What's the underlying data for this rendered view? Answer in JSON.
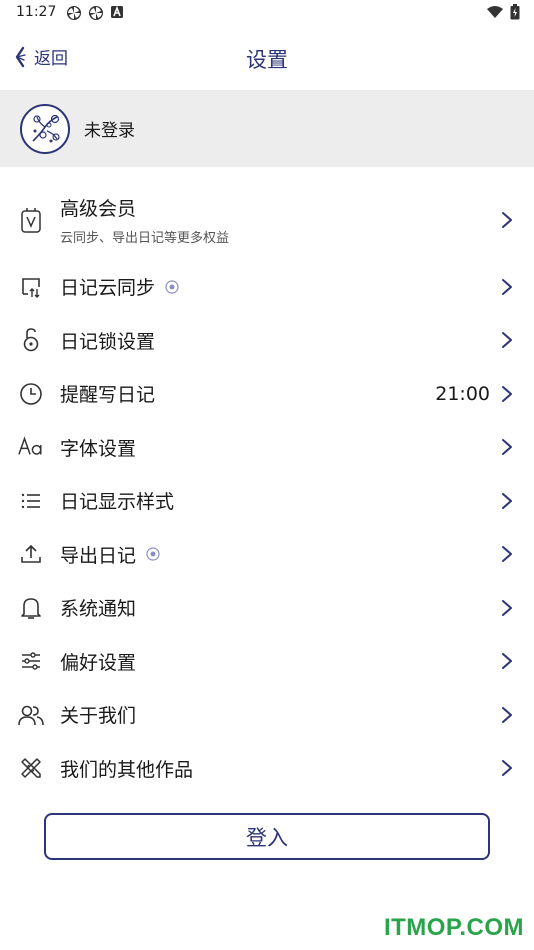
{
  "status_bar": {
    "time": "11:27",
    "left_icons": [
      "pinwheel-icon",
      "pinwheel-icon",
      "a-box-icon"
    ],
    "right_icons": [
      "wifi-icon",
      "battery-icon"
    ]
  },
  "header": {
    "back_label": "返回",
    "title": "设置",
    "back_icon": "back-arrow-icon"
  },
  "profile": {
    "name": "未登录",
    "avatar_icon": "avatar-plum-blossom-icon"
  },
  "menu": {
    "items": [
      {
        "id": "premium",
        "icon": "membership-icon",
        "label": "高级会员",
        "subtitle": "云同步、导出日记等更多权益"
      },
      {
        "id": "sync",
        "icon": "cloud-sync-icon",
        "label": "日记云同步",
        "badge": "premium-badge-icon"
      },
      {
        "id": "lock",
        "icon": "lock-icon",
        "label": "日记锁设置"
      },
      {
        "id": "reminder",
        "icon": "clock-icon",
        "label": "提醒写日记",
        "value": "21:00"
      },
      {
        "id": "font",
        "icon": "font-icon",
        "label": "字体设置"
      },
      {
        "id": "display",
        "icon": "list-icon",
        "label": "日记显示样式"
      },
      {
        "id": "export",
        "icon": "export-icon",
        "label": "导出日记",
        "badge": "premium-badge-icon"
      },
      {
        "id": "notify",
        "icon": "bell-icon",
        "label": "系统通知"
      },
      {
        "id": "prefs",
        "icon": "sliders-icon",
        "label": "偏好设置"
      },
      {
        "id": "about",
        "icon": "people-icon",
        "label": "关于我们"
      },
      {
        "id": "works",
        "icon": "tools-icon",
        "label": "我们的其他作品"
      }
    ]
  },
  "login_button": {
    "label": "登入"
  },
  "watermark": "ITMOP.COM",
  "colors": {
    "accent": "#2c3577",
    "profile_bg": "#ededed",
    "watermark": "#2aa44a"
  }
}
